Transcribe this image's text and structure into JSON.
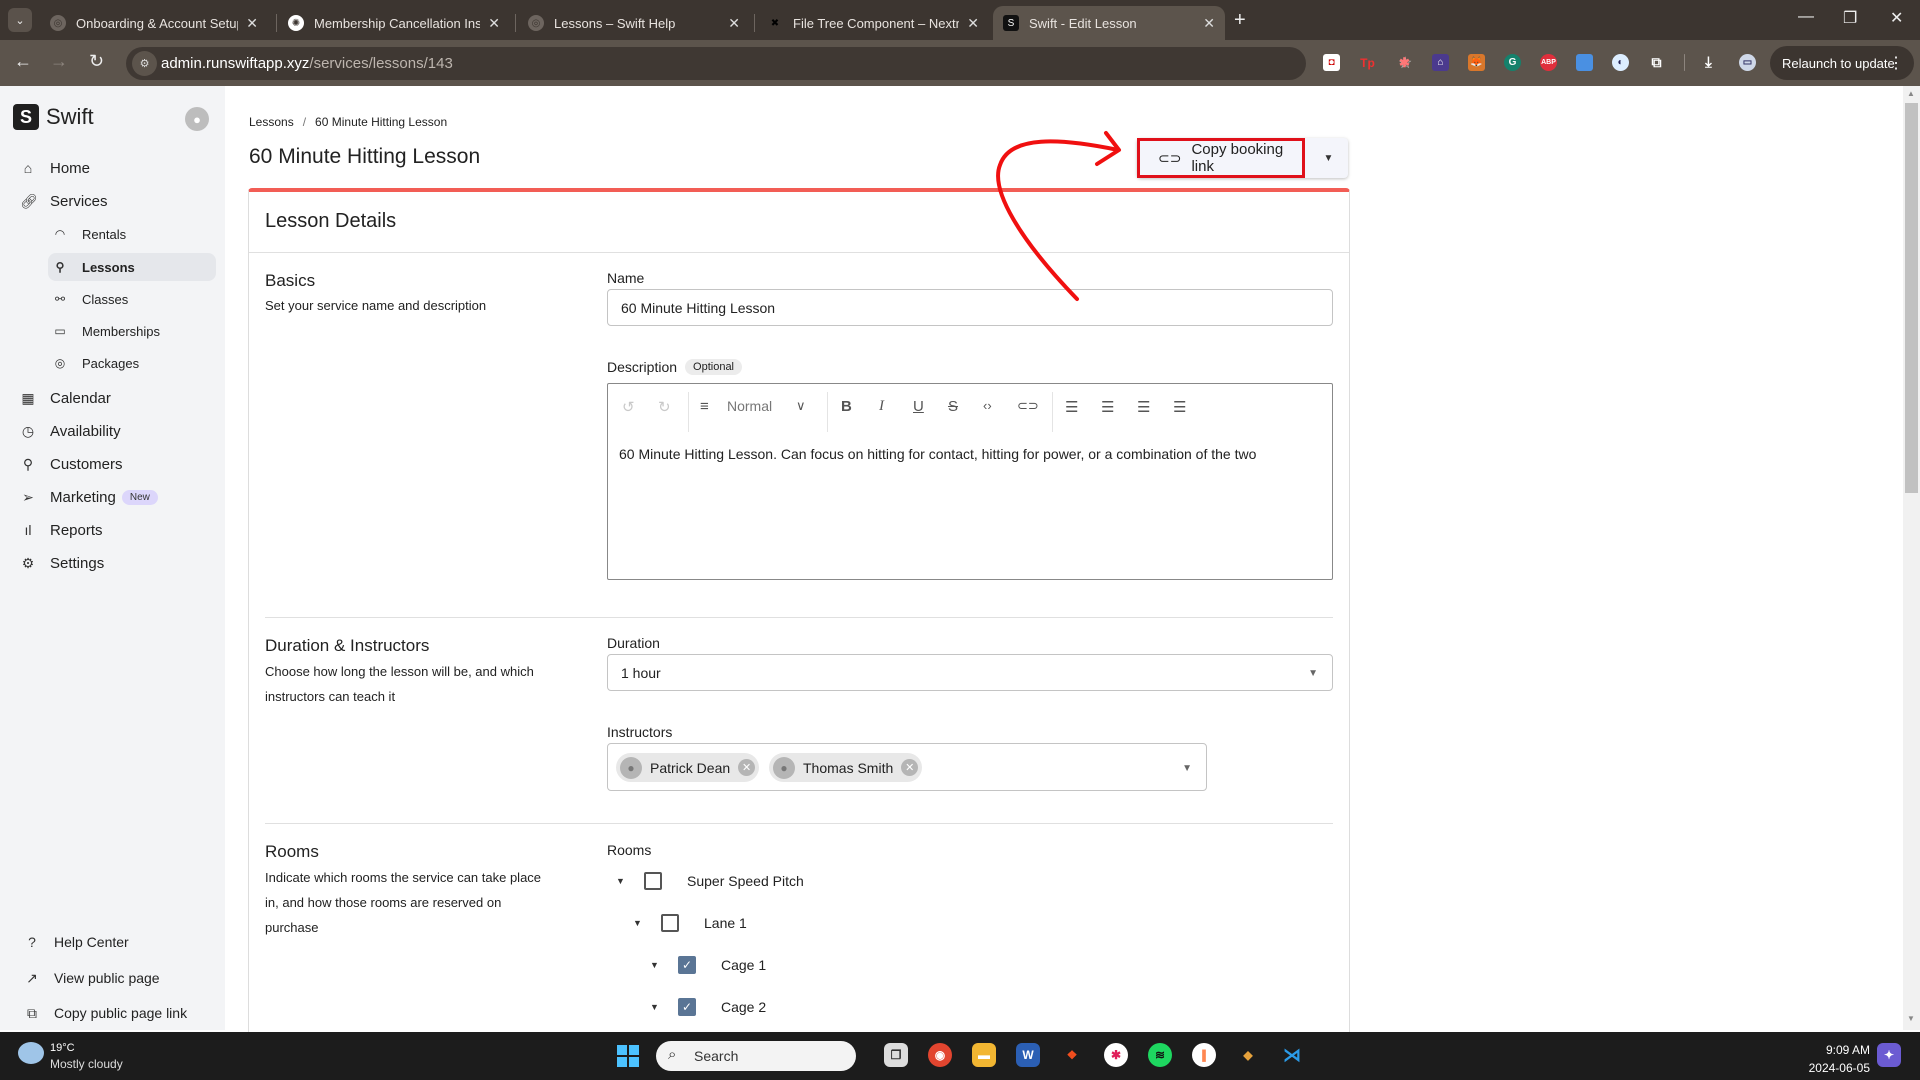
{
  "browser": {
    "tabs": [
      {
        "title": "Onboarding & Account Setup –",
        "icon": "globe-icon",
        "active": false
      },
      {
        "title": "Membership Cancellation Instru",
        "icon": "chatgpt-icon",
        "active": false
      },
      {
        "title": "Lessons – Swift Help",
        "icon": "globe-icon",
        "active": false
      },
      {
        "title": "File Tree Component – Nextra",
        "icon": "nextra-icon",
        "active": false
      },
      {
        "title": "Swift - Edit Lesson",
        "icon": "swift-icon",
        "active": true
      }
    ],
    "url_host": "admin.runswiftapp.xyz",
    "url_path": "/services/lessons/143",
    "relaunch_label": "Relaunch to update",
    "extensions": [
      "mcafee-icon",
      "tp-icon",
      "extension-icon",
      "extension-icon",
      "metamask-icon",
      "grammarly-icon",
      "adblock-icon",
      "extension-icon",
      "extension-icon",
      "puzzle-icon"
    ],
    "adblock_label": "ABP",
    "grammarly_label": "G",
    "tp_label": "Tp"
  },
  "app": {
    "brand": "Swift",
    "logo_letter": "S"
  },
  "sidebar": {
    "items": [
      {
        "label": "Home",
        "icon": "home-icon"
      },
      {
        "label": "Services",
        "icon": "link-icon"
      },
      {
        "label": "Calendar",
        "icon": "calendar-icon"
      },
      {
        "label": "Availability",
        "icon": "clock-icon"
      },
      {
        "label": "Customers",
        "icon": "user-icon"
      },
      {
        "label": "Marketing",
        "icon": "send-icon",
        "badge": "New"
      },
      {
        "label": "Reports",
        "icon": "bar-chart-icon"
      },
      {
        "label": "Settings",
        "icon": "gear-icon"
      }
    ],
    "subitems": [
      {
        "label": "Rentals",
        "icon": "gauge-icon"
      },
      {
        "label": "Lessons",
        "icon": "user-icon",
        "active": true
      },
      {
        "label": "Classes",
        "icon": "users-icon"
      },
      {
        "label": "Memberships",
        "icon": "card-icon"
      },
      {
        "label": "Packages",
        "icon": "coins-icon"
      }
    ],
    "footer": [
      {
        "label": "Help Center",
        "icon": "help-icon"
      },
      {
        "label": "View public page",
        "icon": "external-link-icon"
      },
      {
        "label": "Copy public page link",
        "icon": "copy-icon"
      }
    ]
  },
  "page": {
    "breadcrumb": [
      "Lessons",
      "60 Minute Hitting Lesson"
    ],
    "breadcrumb_sep": "/",
    "title": "60 Minute Hitting Lesson",
    "copy_link_label": "Copy booking link",
    "card_title": "Lesson Details",
    "basics": {
      "title": "Basics",
      "desc": "Set your service name and description",
      "name_label": "Name",
      "name_value": "60 Minute Hitting Lesson",
      "description_label": "Description",
      "optional_badge": "Optional",
      "editor_style": "Normal",
      "editor_text": "60 Minute Hitting Lesson. Can focus on hitting for contact, hitting for power, or a combination of the two"
    },
    "duration": {
      "title": "Duration & Instructors",
      "desc": "Choose how long the lesson will be, and which instructors can teach it",
      "duration_label": "Duration",
      "duration_value": "1 hour",
      "instructors_label": "Instructors",
      "instructors": [
        "Patrick Dean",
        "Thomas Smith"
      ]
    },
    "rooms": {
      "title": "Rooms",
      "desc": "Indicate which rooms the service can take place in, and how those rooms are reserved on purchase",
      "label": "Rooms",
      "tree": [
        {
          "label": "Super Speed Pitch",
          "level": 0,
          "checked": false
        },
        {
          "label": "Lane 1",
          "level": 1,
          "checked": false
        },
        {
          "label": "Cage 1",
          "level": 2,
          "checked": true
        },
        {
          "label": "Cage 2",
          "level": 2,
          "checked": true
        }
      ]
    }
  },
  "annotation": {
    "color": "#e0101a"
  },
  "taskbar": {
    "temperature": "19°C",
    "weather": "Mostly cloudy",
    "search_placeholder": "Search",
    "time": "9:09 AM",
    "date": "2024-06-05"
  }
}
